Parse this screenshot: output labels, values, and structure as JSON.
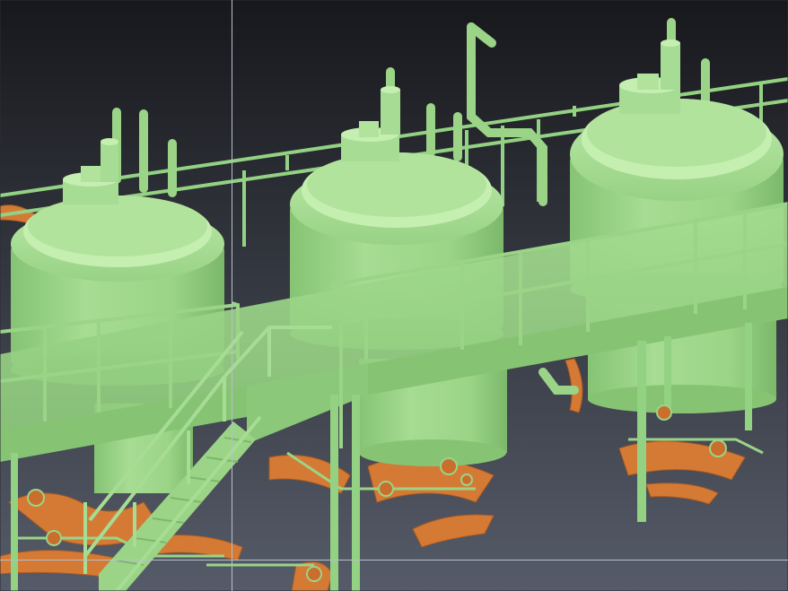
{
  "scene": {
    "description_free": true,
    "colors": {
      "background_top": "#17181c",
      "background_bottom": "#555b68",
      "vessel": "#9fd88c",
      "vessel_light": "#c5efb0",
      "vessel_shadow": "#79b56a",
      "steel": "#93d183",
      "piping_orange": "#d57a35",
      "piping_orange_dark": "#a95a22",
      "guide_line": "#b9bfcc"
    },
    "guides": {
      "vertical": true,
      "horizontal": true
    },
    "tank_count": 3
  }
}
